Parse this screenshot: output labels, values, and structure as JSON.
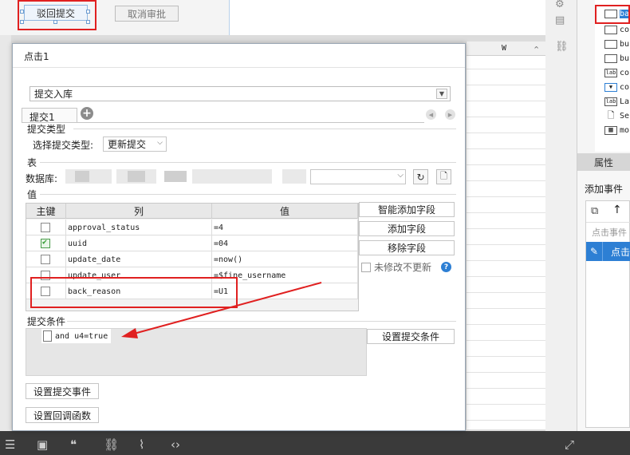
{
  "toolbar": {
    "reject_label": "驳回提交",
    "cancel_label": "取消审批"
  },
  "background": {
    "grid_col_header": "W"
  },
  "right_panel": {
    "tree_items": [
      {
        "icon": "button-icon",
        "text": "ba"
      },
      {
        "icon": "button-icon",
        "text": "co"
      },
      {
        "icon": "button-icon",
        "text": "bu"
      },
      {
        "icon": "button-icon",
        "text": "bu"
      },
      {
        "icon": "label-icon",
        "text": "co"
      },
      {
        "icon": "dropdown-icon",
        "text": "co"
      },
      {
        "icon": "label-icon",
        "text": "La"
      },
      {
        "icon": "search-doc-icon",
        "text": "Se"
      },
      {
        "icon": "grid-icon",
        "text": "mo"
      }
    ],
    "properties_tab": "属性",
    "add_event": "添加事件",
    "click_event_hint": "点击事件",
    "selected_event": "点击"
  },
  "dialog": {
    "title": "点击1",
    "submit_type": "提交入库",
    "tab_label": "提交1",
    "section_submit_type": "提交类型",
    "choose_type_label": "选择提交类型:",
    "type_value": "更新提交",
    "section_table": "表",
    "database_label": "数据库:",
    "section_value": "值",
    "grid": {
      "headers": [
        "主键",
        "列",
        "值"
      ],
      "rows": [
        {
          "checked": false,
          "column": "approval_status",
          "value": "=4"
        },
        {
          "checked": true,
          "column": "uuid",
          "value": "=04"
        },
        {
          "checked": false,
          "column": "update_date",
          "value": "=now()"
        },
        {
          "checked": false,
          "column": "update_user",
          "value": "=$fine_username"
        },
        {
          "checked": false,
          "column": "back_reason",
          "value": "=U1"
        }
      ]
    },
    "btn_smart_add": "智能添加字段",
    "btn_add_field": "添加字段",
    "btn_remove_field": "移除字段",
    "unchanged_no_update": "未修改不更新",
    "section_condition": "提交条件",
    "condition_item": "and u4=true",
    "btn_set_condition": "设置提交条件",
    "btn_set_submit_event": "设置提交事件",
    "btn_set_callback": "设置回调函数"
  },
  "colors": {
    "annotation_red": "#e02020",
    "selection_blue": "#2d7fd4"
  }
}
